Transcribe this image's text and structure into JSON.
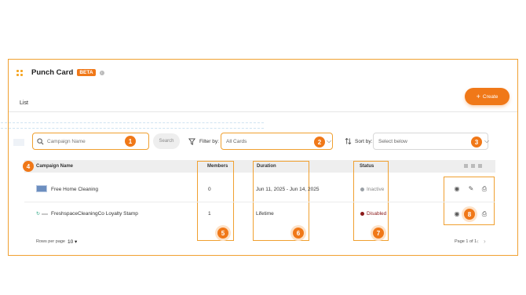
{
  "app": {
    "title": "Punch Card",
    "beta_label": "BETA"
  },
  "tabs": [
    {
      "label": "List"
    }
  ],
  "toolbar": {
    "create_label": "Create",
    "search_placeholder": "Campaign Name",
    "search_button": "Search",
    "filter_label": "Filter by:",
    "filter_value": "All Cards",
    "sort_label": "Sort by:",
    "sort_placeholder": "Select below"
  },
  "table": {
    "columns": [
      "Campaign Name",
      "Members",
      "Duration",
      "Status"
    ],
    "rows": [
      {
        "name": "Free Home Cleaning",
        "members": "0",
        "duration": "Jun 11, 2025 - Jun 14, 2025",
        "status": "Inactive",
        "status_color": "#9aa0a6"
      },
      {
        "name": "FreshspaceCleaningCo Loyalty Stamp",
        "members": "1",
        "duration": "Lifetime",
        "status": "Disabled",
        "status_color": "#8b1a1a"
      }
    ]
  },
  "footer": {
    "rows_per_page_label": "Rows per page",
    "rows_per_page_value": "10",
    "page_info": "Page 1 of 1"
  },
  "annotations": {
    "badges": [
      "1",
      "2",
      "3",
      "4",
      "5",
      "6",
      "7",
      "8"
    ]
  },
  "colors": {
    "accent": "#f07818",
    "highlight_border": "#f0a030"
  }
}
